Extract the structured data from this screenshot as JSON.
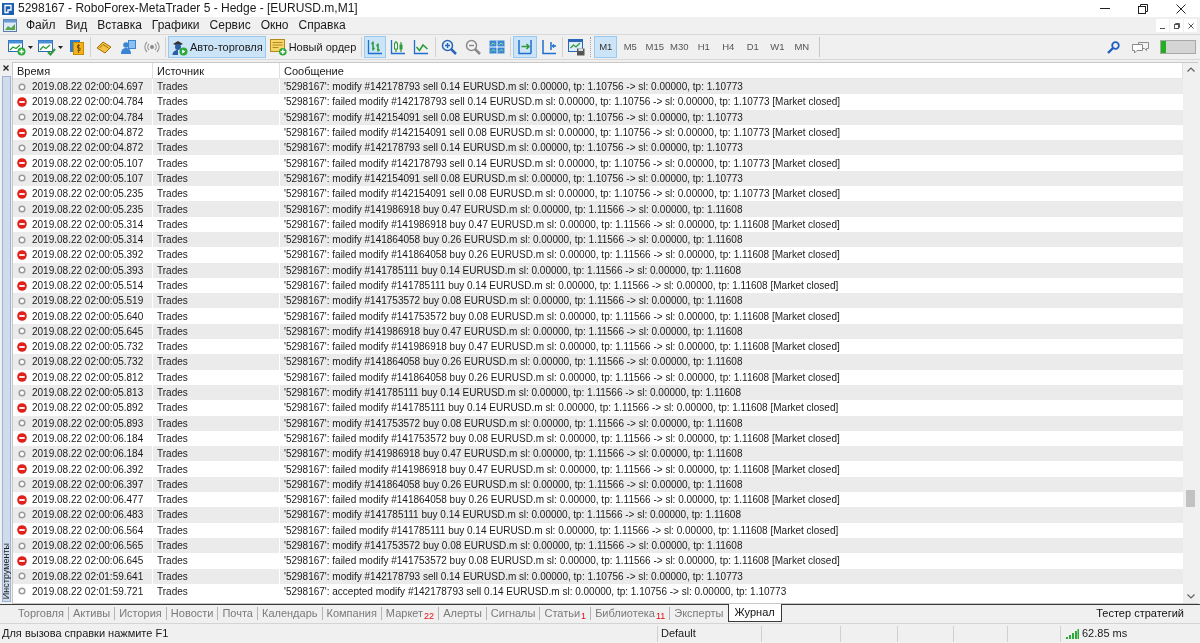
{
  "window": {
    "title": "5298167 - RoboForex-MetaTrader 5 - Hedge - [EURUSD.m,M1]"
  },
  "menu": [
    "Файл",
    "Вид",
    "Вставка",
    "Графики",
    "Сервис",
    "Окно",
    "Справка"
  ],
  "toolbar": {
    "auto_trading": {
      "label": "Авто-торговля",
      "selected": true
    },
    "new_order": {
      "label": "Новый ордер"
    },
    "chart_types": [
      {
        "selected": true
      },
      {
        "selected": false
      },
      {
        "selected": false
      }
    ],
    "autoscroll": {
      "selected": true
    },
    "chart_shift": {
      "selected": false
    },
    "timeframes": [
      {
        "label": "M1",
        "selected": true
      },
      {
        "label": "M5",
        "selected": false
      },
      {
        "label": "M15",
        "selected": false
      },
      {
        "label": "M30",
        "selected": false
      },
      {
        "label": "H1",
        "selected": false
      },
      {
        "label": "H4",
        "selected": false
      },
      {
        "label": "D1",
        "selected": false
      },
      {
        "label": "W1",
        "selected": false
      },
      {
        "label": "MN",
        "selected": false
      }
    ],
    "meter": {
      "level": 0.15
    }
  },
  "panel": {
    "title": "Инструменты"
  },
  "journal": {
    "columns": [
      "Время",
      "Источник",
      "Сообщение"
    ],
    "rows": [
      {
        "kind": "info",
        "time": "2019.08.22 02:00:04.697",
        "source": "Trades",
        "message": "'5298167': modify #142178793 sell 0.14 EURUSD.m sl: 0.00000, tp: 1.10756 -> sl: 0.00000, tp: 1.10773"
      },
      {
        "kind": "error",
        "time": "2019.08.22 02:00:04.784",
        "source": "Trades",
        "message": "'5298167': failed modify #142178793 sell 0.14 EURUSD.m sl: 0.00000, tp: 1.10756 -> sl: 0.00000, tp: 1.10773 [Market closed]"
      },
      {
        "kind": "info",
        "time": "2019.08.22 02:00:04.784",
        "source": "Trades",
        "message": "'5298167': modify #142154091 sell 0.08 EURUSD.m sl: 0.00000, tp: 1.10756 -> sl: 0.00000, tp: 1.10773"
      },
      {
        "kind": "error",
        "time": "2019.08.22 02:00:04.872",
        "source": "Trades",
        "message": "'5298167': failed modify #142154091 sell 0.08 EURUSD.m sl: 0.00000, tp: 1.10756 -> sl: 0.00000, tp: 1.10773 [Market closed]"
      },
      {
        "kind": "info",
        "time": "2019.08.22 02:00:04.872",
        "source": "Trades",
        "message": "'5298167': modify #142178793 sell 0.14 EURUSD.m sl: 0.00000, tp: 1.10756 -> sl: 0.00000, tp: 1.10773"
      },
      {
        "kind": "error",
        "time": "2019.08.22 02:00:05.107",
        "source": "Trades",
        "message": "'5298167': failed modify #142178793 sell 0.14 EURUSD.m sl: 0.00000, tp: 1.10756 -> sl: 0.00000, tp: 1.10773 [Market closed]"
      },
      {
        "kind": "info",
        "time": "2019.08.22 02:00:05.107",
        "source": "Trades",
        "message": "'5298167': modify #142154091 sell 0.08 EURUSD.m sl: 0.00000, tp: 1.10756 -> sl: 0.00000, tp: 1.10773"
      },
      {
        "kind": "error",
        "time": "2019.08.22 02:00:05.235",
        "source": "Trades",
        "message": "'5298167': failed modify #142154091 sell 0.08 EURUSD.m sl: 0.00000, tp: 1.10756 -> sl: 0.00000, tp: 1.10773 [Market closed]"
      },
      {
        "kind": "info",
        "time": "2019.08.22 02:00:05.235",
        "source": "Trades",
        "message": "'5298167': modify #141986918 buy 0.47 EURUSD.m sl: 0.00000, tp: 1.11566 -> sl: 0.00000, tp: 1.11608"
      },
      {
        "kind": "error",
        "time": "2019.08.22 02:00:05.314",
        "source": "Trades",
        "message": "'5298167': failed modify #141986918 buy 0.47 EURUSD.m sl: 0.00000, tp: 1.11566 -> sl: 0.00000, tp: 1.11608 [Market closed]"
      },
      {
        "kind": "info",
        "time": "2019.08.22 02:00:05.314",
        "source": "Trades",
        "message": "'5298167': modify #141864058 buy 0.26 EURUSD.m sl: 0.00000, tp: 1.11566 -> sl: 0.00000, tp: 1.11608"
      },
      {
        "kind": "error",
        "time": "2019.08.22 02:00:05.392",
        "source": "Trades",
        "message": "'5298167': failed modify #141864058 buy 0.26 EURUSD.m sl: 0.00000, tp: 1.11566 -> sl: 0.00000, tp: 1.11608 [Market closed]"
      },
      {
        "kind": "info",
        "time": "2019.08.22 02:00:05.393",
        "source": "Trades",
        "message": "'5298167': modify #141785111 buy 0.14 EURUSD.m sl: 0.00000, tp: 1.11566 -> sl: 0.00000, tp: 1.11608"
      },
      {
        "kind": "error",
        "time": "2019.08.22 02:00:05.514",
        "source": "Trades",
        "message": "'5298167': failed modify #141785111 buy 0.14 EURUSD.m sl: 0.00000, tp: 1.11566 -> sl: 0.00000, tp: 1.11608 [Market closed]"
      },
      {
        "kind": "info",
        "time": "2019.08.22 02:00:05.519",
        "source": "Trades",
        "message": "'5298167': modify #141753572 buy 0.08 EURUSD.m sl: 0.00000, tp: 1.11566 -> sl: 0.00000, tp: 1.11608"
      },
      {
        "kind": "error",
        "time": "2019.08.22 02:00:05.640",
        "source": "Trades",
        "message": "'5298167': failed modify #141753572 buy 0.08 EURUSD.m sl: 0.00000, tp: 1.11566 -> sl: 0.00000, tp: 1.11608 [Market closed]"
      },
      {
        "kind": "info",
        "time": "2019.08.22 02:00:05.645",
        "source": "Trades",
        "message": "'5298167': modify #141986918 buy 0.47 EURUSD.m sl: 0.00000, tp: 1.11566 -> sl: 0.00000, tp: 1.11608"
      },
      {
        "kind": "error",
        "time": "2019.08.22 02:00:05.732",
        "source": "Trades",
        "message": "'5298167': failed modify #141986918 buy 0.47 EURUSD.m sl: 0.00000, tp: 1.11566 -> sl: 0.00000, tp: 1.11608 [Market closed]"
      },
      {
        "kind": "info",
        "time": "2019.08.22 02:00:05.732",
        "source": "Trades",
        "message": "'5298167': modify #141864058 buy 0.26 EURUSD.m sl: 0.00000, tp: 1.11566 -> sl: 0.00000, tp: 1.11608"
      },
      {
        "kind": "error",
        "time": "2019.08.22 02:00:05.812",
        "source": "Trades",
        "message": "'5298167': failed modify #141864058 buy 0.26 EURUSD.m sl: 0.00000, tp: 1.11566 -> sl: 0.00000, tp: 1.11608 [Market closed]"
      },
      {
        "kind": "info",
        "time": "2019.08.22 02:00:05.813",
        "source": "Trades",
        "message": "'5298167': modify #141785111 buy 0.14 EURUSD.m sl: 0.00000, tp: 1.11566 -> sl: 0.00000, tp: 1.11608"
      },
      {
        "kind": "error",
        "time": "2019.08.22 02:00:05.892",
        "source": "Trades",
        "message": "'5298167': failed modify #141785111 buy 0.14 EURUSD.m sl: 0.00000, tp: 1.11566 -> sl: 0.00000, tp: 1.11608 [Market closed]"
      },
      {
        "kind": "info",
        "time": "2019.08.22 02:00:05.893",
        "source": "Trades",
        "message": "'5298167': modify #141753572 buy 0.08 EURUSD.m sl: 0.00000, tp: 1.11566 -> sl: 0.00000, tp: 1.11608"
      },
      {
        "kind": "error",
        "time": "2019.08.22 02:00:06.184",
        "source": "Trades",
        "message": "'5298167': failed modify #141753572 buy 0.08 EURUSD.m sl: 0.00000, tp: 1.11566 -> sl: 0.00000, tp: 1.11608 [Market closed]"
      },
      {
        "kind": "info",
        "time": "2019.08.22 02:00:06.184",
        "source": "Trades",
        "message": "'5298167': modify #141986918 buy 0.47 EURUSD.m sl: 0.00000, tp: 1.11566 -> sl: 0.00000, tp: 1.11608"
      },
      {
        "kind": "error",
        "time": "2019.08.22 02:00:06.392",
        "source": "Trades",
        "message": "'5298167': failed modify #141986918 buy 0.47 EURUSD.m sl: 0.00000, tp: 1.11566 -> sl: 0.00000, tp: 1.11608 [Market closed]"
      },
      {
        "kind": "info",
        "time": "2019.08.22 02:00:06.397",
        "source": "Trades",
        "message": "'5298167': modify #141864058 buy 0.26 EURUSD.m sl: 0.00000, tp: 1.11566 -> sl: 0.00000, tp: 1.11608"
      },
      {
        "kind": "error",
        "time": "2019.08.22 02:00:06.477",
        "source": "Trades",
        "message": "'5298167': failed modify #141864058 buy 0.26 EURUSD.m sl: 0.00000, tp: 1.11566 -> sl: 0.00000, tp: 1.11608 [Market closed]"
      },
      {
        "kind": "info",
        "time": "2019.08.22 02:00:06.483",
        "source": "Trades",
        "message": "'5298167': modify #141785111 buy 0.14 EURUSD.m sl: 0.00000, tp: 1.11566 -> sl: 0.00000, tp: 1.11608"
      },
      {
        "kind": "error",
        "time": "2019.08.22 02:00:06.564",
        "source": "Trades",
        "message": "'5298167': failed modify #141785111 buy 0.14 EURUSD.m sl: 0.00000, tp: 1.11566 -> sl: 0.00000, tp: 1.11608 [Market closed]"
      },
      {
        "kind": "info",
        "time": "2019.08.22 02:00:06.565",
        "source": "Trades",
        "message": "'5298167': modify #141753572 buy 0.08 EURUSD.m sl: 0.00000, tp: 1.11566 -> sl: 0.00000, tp: 1.11608"
      },
      {
        "kind": "error",
        "time": "2019.08.22 02:00:06.645",
        "source": "Trades",
        "message": "'5298167': failed modify #141753572 buy 0.08 EURUSD.m sl: 0.00000, tp: 1.11566 -> sl: 0.00000, tp: 1.11608 [Market closed]"
      },
      {
        "kind": "info",
        "time": "2019.08.22 02:01:59.641",
        "source": "Trades",
        "message": "'5298167': modify #142178793 sell 0.14 EURUSD.m sl: 0.00000, tp: 1.10756 -> sl: 0.00000, tp: 1.10773"
      },
      {
        "kind": "info",
        "time": "2019.08.22 02:01:59.721",
        "source": "Trades",
        "message": "'5298167': accepted modify #142178793 sell 0.14 EURUSD.m sl: 0.00000, tp: 1.10756 -> sl: 0.00000, tp: 1.10773"
      }
    ]
  },
  "tabs": [
    {
      "label": "Торговля",
      "selected": false
    },
    {
      "label": "Активы",
      "selected": false
    },
    {
      "label": "История",
      "selected": false
    },
    {
      "label": "Новости",
      "selected": false
    },
    {
      "label": "Почта",
      "selected": false
    },
    {
      "label": "Календарь",
      "selected": false
    },
    {
      "label": "Компания",
      "selected": false
    },
    {
      "label": "Маркет",
      "badge": "22",
      "selected": false
    },
    {
      "label": "Алерты",
      "selected": false
    },
    {
      "label": "Сигналы",
      "selected": false
    },
    {
      "label": "Статьи",
      "badge": "1",
      "selected": false
    },
    {
      "label": "Библиотека",
      "badge": "11",
      "selected": false
    },
    {
      "label": "Эксперты",
      "selected": false
    },
    {
      "label": "Журнал",
      "selected": true
    }
  ],
  "strategy_tester": "Тестер стратегий",
  "status_bar": {
    "help": "Для вызова справки нажмите F1",
    "profile": "Default",
    "ping": "62.85 ms"
  }
}
